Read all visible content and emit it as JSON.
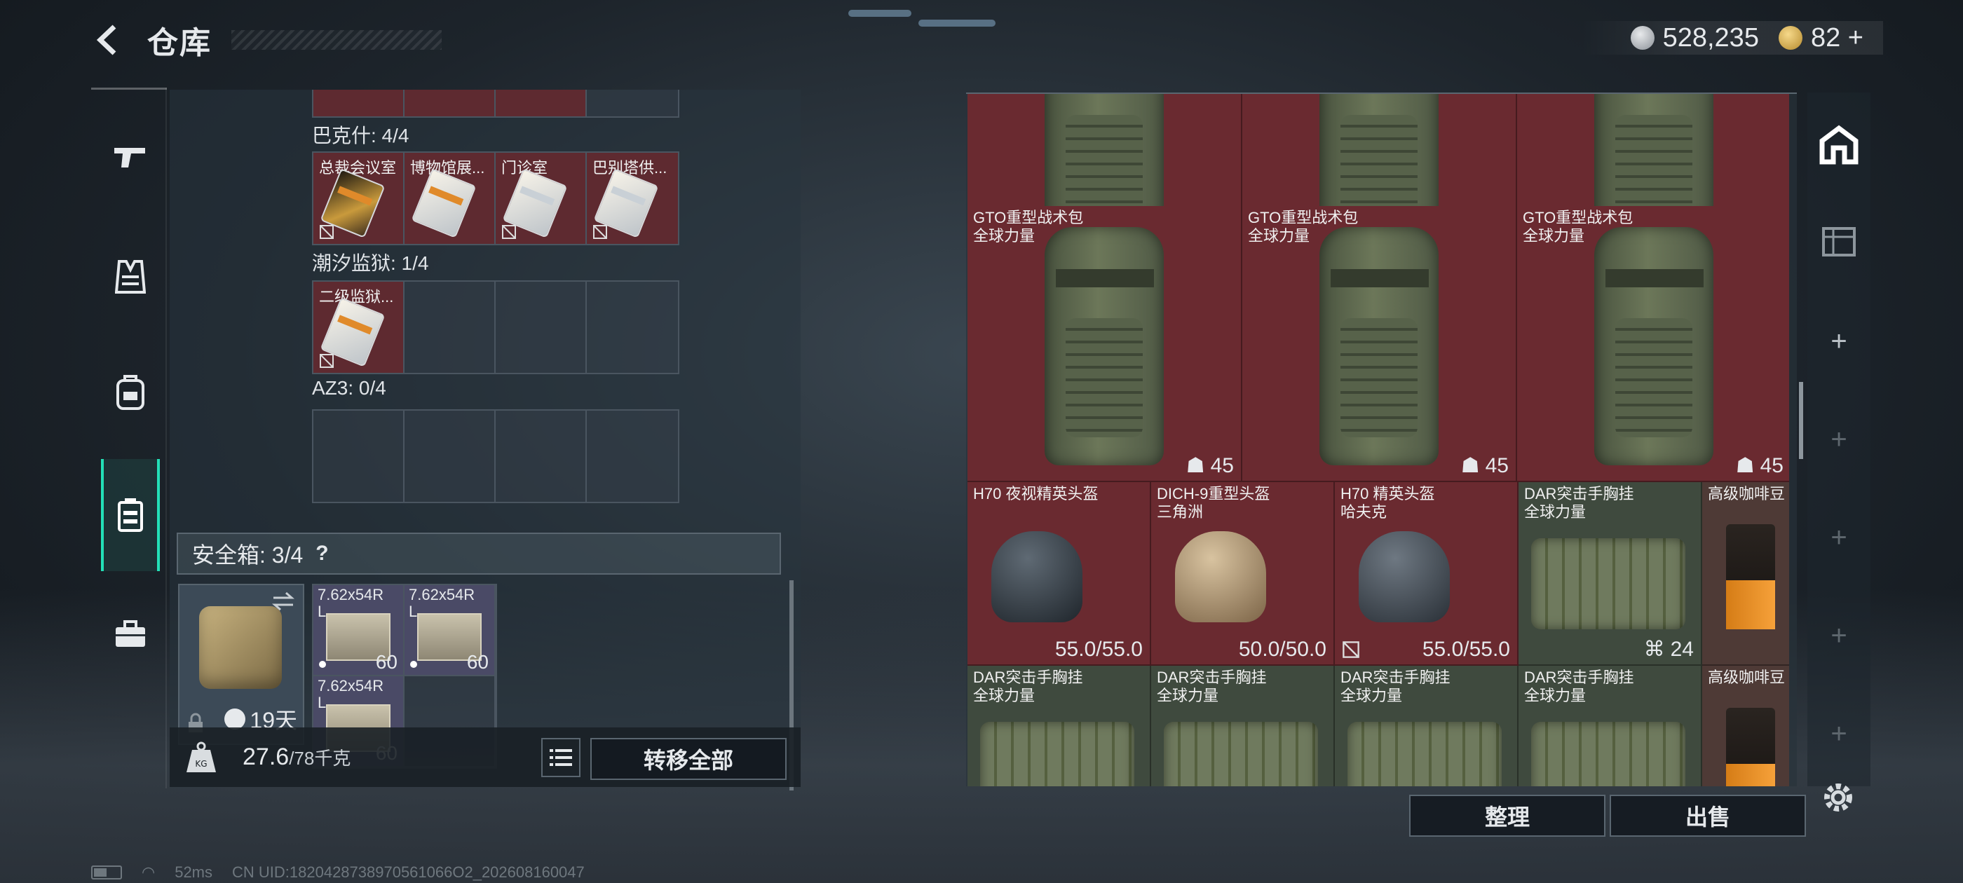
{
  "header": {
    "title": "仓库",
    "currency_silver": "528,235",
    "currency_gold": "82 +"
  },
  "left_rail": {
    "items": [
      "weapon-icon",
      "vest-icon",
      "backpack-icon",
      "container-icon",
      "briefcase-icon"
    ],
    "active_index": 3
  },
  "left_panel": {
    "top_partial_row": [
      "",
      "",
      "",
      ""
    ],
    "groups": [
      {
        "label": "巴克什: 4/4",
        "slots": [
          {
            "name": "总裁会议室",
            "color": "gold"
          },
          {
            "name": "博物馆展...",
            "color": "white"
          },
          {
            "name": "门诊室",
            "color": "white"
          },
          {
            "name": "巴别塔供...",
            "color": "white"
          }
        ]
      },
      {
        "label": "潮汐监狱: 1/4",
        "slots": [
          {
            "name": "二级监狱...",
            "color": "white"
          },
          null,
          null,
          null
        ]
      },
      {
        "label": "AZ3: 0/4",
        "slots": [
          null,
          null,
          null,
          null
        ]
      }
    ],
    "safebox": {
      "label": "安全箱: 3/4",
      "help": "?",
      "days": "19天"
    },
    "ammo": [
      {
        "name": "7.62x54R L...",
        "count": "60"
      },
      {
        "name": "7.62x54R L...",
        "count": "60"
      },
      {
        "name": "7.62x54R L...",
        "count": "60"
      }
    ],
    "weight": {
      "current": "27.6",
      "max": "/78千克"
    },
    "transfer_all_label": "转移全部"
  },
  "stash": {
    "rows": [
      [
        {
          "name": "",
          "type": "backpack",
          "stat": "45",
          "color": "red"
        },
        {
          "name": "",
          "type": "backpack",
          "stat": "45",
          "color": "red"
        },
        {
          "name": "",
          "type": "backpack",
          "stat": "45",
          "color": "red"
        }
      ],
      [
        {
          "name": "GTO重型战术包",
          "sub": "全球力量",
          "stat": "45"
        },
        {
          "name": "GTO重型战术包",
          "sub": "全球力量",
          "stat": "45"
        },
        {
          "name": "GTO重型战术包",
          "sub": "全球力量",
          "stat": "45"
        }
      ]
    ],
    "helmets": [
      {
        "name": "H70 夜视精英头盔",
        "sub": "",
        "stat": "55.0/55.0"
      },
      {
        "name": "DICH-9重型头盔",
        "sub": "三角洲",
        "stat": "50.0/50.0"
      },
      {
        "name": "H70 精英头盔",
        "sub": "哈夫克",
        "stat": "55.0/55.0"
      }
    ],
    "vest_top": {
      "name": "DAR突击手胸挂",
      "sub": "全球力量",
      "stat": "24"
    },
    "coffee_top": {
      "name": "高级咖啡豆"
    },
    "vests_bottom": [
      {
        "name": "DAR突击手胸挂",
        "sub": "全球力量"
      },
      {
        "name": "DAR突击手胸挂",
        "sub": "全球力量"
      },
      {
        "name": "DAR突击手胸挂",
        "sub": "全球力量"
      },
      {
        "name": "DAR突击手胸挂",
        "sub": "全球力量"
      }
    ],
    "coffee_bottom": {
      "name": "高级咖啡豆"
    },
    "sort_label": "整理",
    "sell_label": "出售"
  },
  "status": {
    "ping": "52ms",
    "uid": "CN UID:1820428738970561066O2_202608160047"
  },
  "colors": {
    "accent": "#23e0b7",
    "item_red": "#6a2a30",
    "item_green": "#3f4a3e",
    "ammo_purple": "#4a4a66"
  }
}
